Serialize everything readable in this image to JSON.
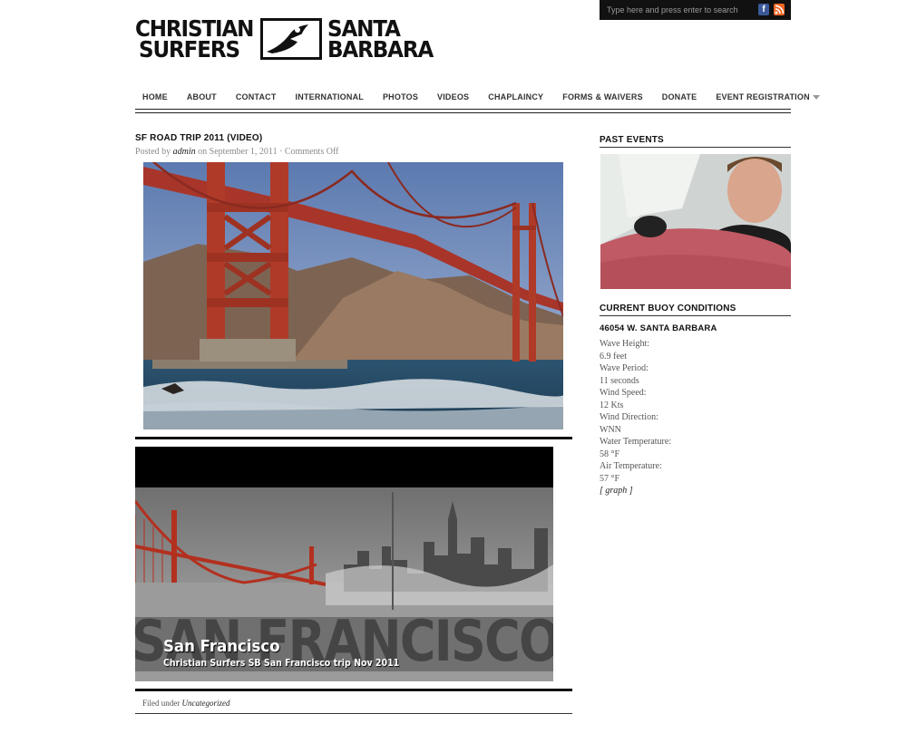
{
  "logo": {
    "line1_left": "Christian",
    "line2_left": "Surfers",
    "line1_right": "Santa",
    "line2_right": "Barbara"
  },
  "search": {
    "placeholder": "Type here and press enter to search"
  },
  "social": {
    "facebook_icon": "facebook-icon",
    "rss_icon": "rss-icon"
  },
  "nav": {
    "items": [
      "HOME",
      "ABOUT",
      "CONTACT",
      "INTERNATIONAL",
      "PHOTOS",
      "VIDEOS",
      "CHAPLAINCY",
      "FORMS & WAIVERS",
      "DONATE",
      "EVENT REGISTRATION"
    ]
  },
  "post": {
    "title": "SF ROAD TRIP 2011 (VIDEO)",
    "posted_by": "Posted by",
    "author": "admin",
    "on": "on September 1, 2011 · Comments Off",
    "video_title": "San Francisco",
    "video_subtitle": "Christian Surfers SB San Francisco trip Nov 2011",
    "video_bg_text": "SAN FRANCISCO",
    "filed_under": "Filed under",
    "category": "Uncategorized"
  },
  "sidebar": {
    "past_events": "PAST EVENTS",
    "buoy_heading": "CURRENT BUOY CONDITIONS",
    "station": "46054 W. SANTA BARBARA",
    "conditions": [
      {
        "label": "Wave Height:",
        "value": "6.9 feet"
      },
      {
        "label": "Wave Period:",
        "value": "11 seconds"
      },
      {
        "label": "Wind Speed:",
        "value": "12 Kts"
      },
      {
        "label": "Wind Direction:",
        "value": "WNN"
      },
      {
        "label": "Water Temperature:",
        "value": "58 °F"
      },
      {
        "label": "Air Temperature:",
        "value": "57 °F"
      }
    ],
    "graph_link": "[ graph ]"
  }
}
